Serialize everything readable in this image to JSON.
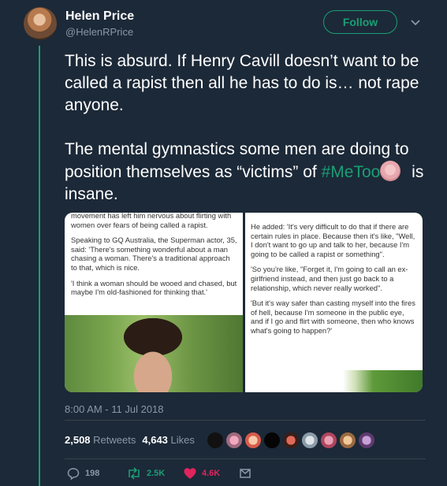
{
  "tweet": {
    "author_name": "Helen Price",
    "author_handle": "@HelenRPrice",
    "follow_label": "Follow",
    "text_para1": "This is absurd. If Henry Cavill doesn’t want to be called a rapist then all he has to do is… not rape anyone.",
    "text_para2_before": "The mental gymnastics some men are doing to position themselves as “victims” of ",
    "hashtag": "#MeToo",
    "text_para2_after": " is insane.",
    "timestamp": "8:00 AM - 11 Jul 2018"
  },
  "media": {
    "left_paragraphs": [
      "movement has left him nervous about flirting with women over fears of being called a rapist.",
      "Speaking to GQ Australia, the Superman actor, 35, said: 'There's something wonderful about a man chasing a woman. There's a traditional approach to that, which is nice.",
      "'I think a woman should be wooed and chased, but maybe I'm old-fashioned for thinking that.'"
    ],
    "right_paragraphs": [
      "He added: 'It's very difficult to do that if there are certain rules in place. Because then it's like, \"Well, I don't want to go up and talk to her, because I'm going to be called a rapist or something\".",
      "'So you're like, \"Forget it, I'm going to call an ex-girlfriend instead, and then just go back to a relationship, which never really worked\".",
      "'But it's way safer than casting myself into the fires of hell, because I'm someone in the public eye, and if I go and flirt with someone, then who knows what's going to happen?'"
    ]
  },
  "stats": {
    "retweets_count": "2,508",
    "retweets_label": "Retweets",
    "likes_count": "4,643",
    "likes_label": "Likes"
  },
  "actions": {
    "replies": "198",
    "retweets": "2.5K",
    "likes": "4.6K"
  },
  "colors": {
    "background": "#1c2938",
    "accent": "#1a9e75",
    "like": "#e0245e",
    "muted": "#8899a6"
  },
  "icons": [
    "caret-down-icon",
    "reply-icon",
    "retweet-icon",
    "heart-icon",
    "dm-icon"
  ]
}
